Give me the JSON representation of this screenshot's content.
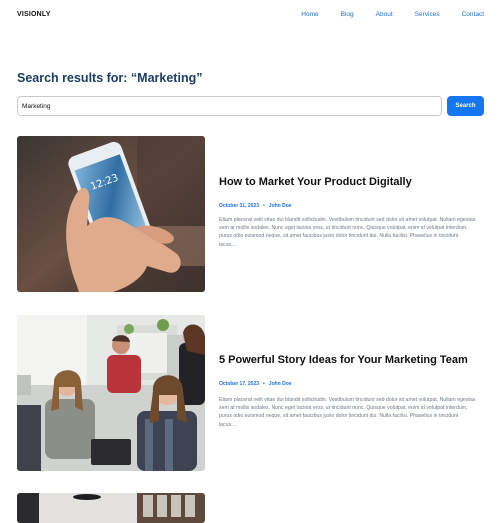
{
  "site": {
    "logo": "VISIONLY"
  },
  "nav": {
    "items": [
      "Home",
      "Blog",
      "About",
      "Services",
      "Contact"
    ]
  },
  "search": {
    "heading": "Search results for: “Marketing”",
    "value": "Marketing",
    "button_label": "Search"
  },
  "results": [
    {
      "title": "How to Market Your Product Digitally",
      "date": "October 31, 2023",
      "author": "John Doe",
      "excerpt": "Etiam placerat velit vitae dui blandit sollicitudin. Vestibulum tincidunt sed dolor sit amet volutpat. Nullam egestas sem at mollis sodales. Nunc eget lacinia eros, ut tincidunt nunc. Quisque volutpat, enim id volutpat interdum, purus odio euismod neque, sit amet faucibus justo dolor tincidunt dui. Nulla facilisi. Phasellus in tincidunt lacus,..."
    },
    {
      "title": "5 Powerful Story Ideas for Your Marketing Team",
      "date": "October 17, 2023",
      "author": "John Doe",
      "excerpt": "Etiam placerat velit vitae dui blandit sollicitudin. Vestibulum tincidunt sed dolor sit amet volutpat. Nullam egestas sem at mollis sodales. Nunc eget lacinia eros, ut tincidunt nunc. Quisque volutpat, enim id volutpat interdum, purus odio euismod neque, sit amet faucibus justo dolor tincidunt dui. Nulla facilisi. Phasellus in tincidunt lacus,..."
    }
  ]
}
